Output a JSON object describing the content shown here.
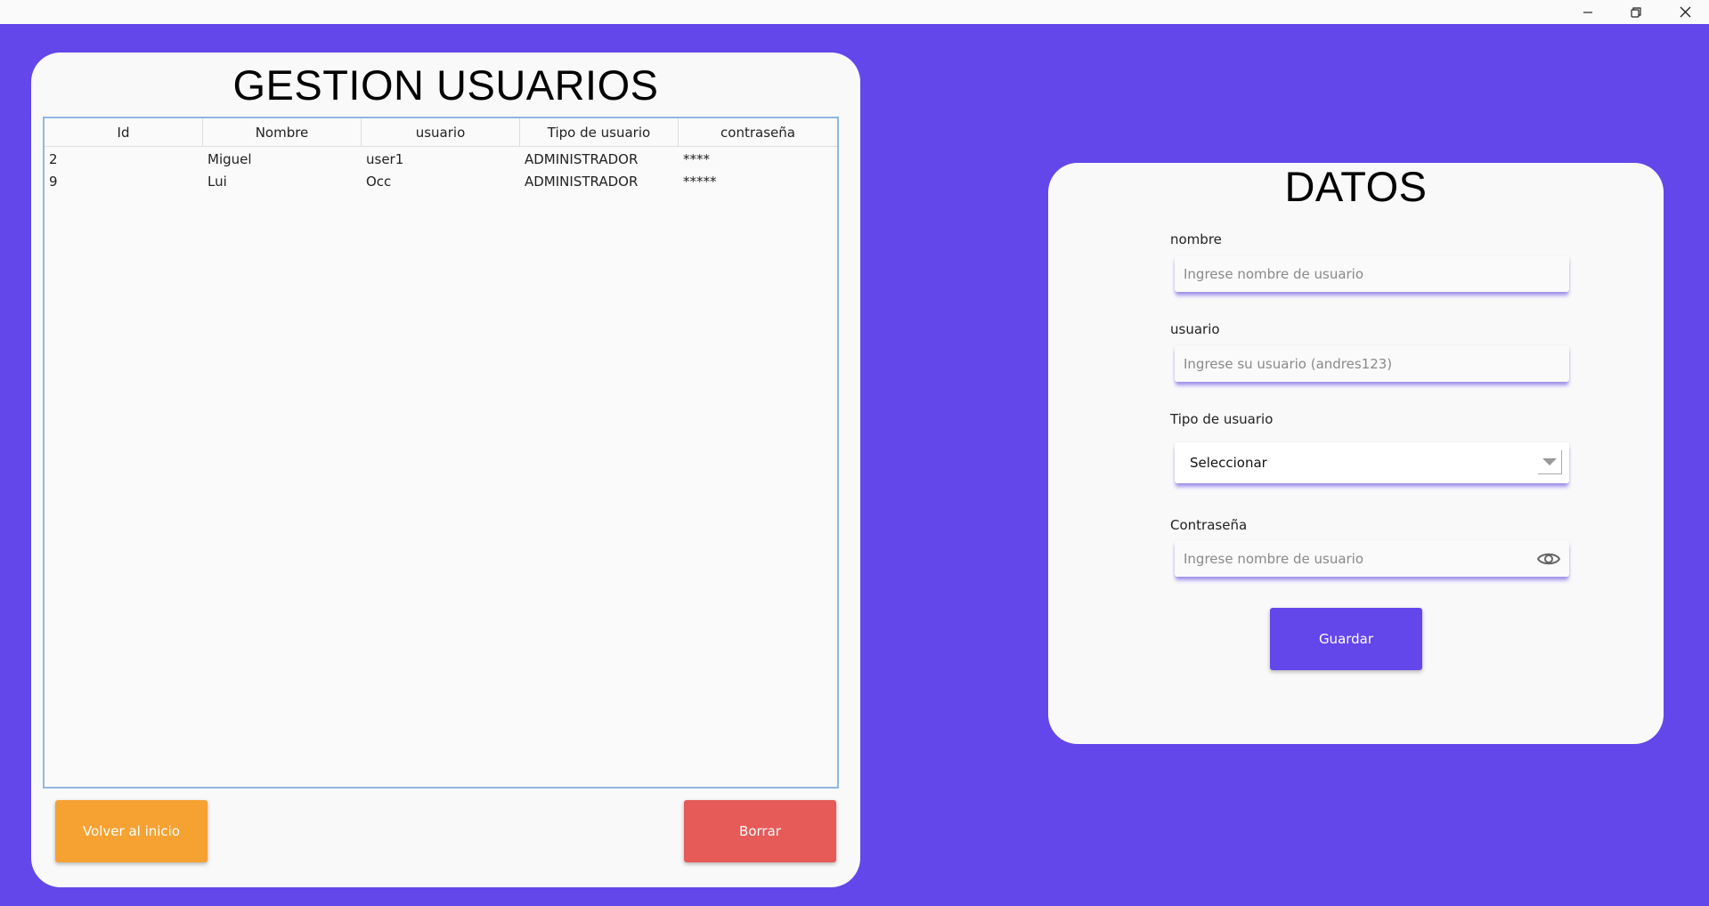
{
  "window": {
    "controls": [
      "minimize-icon",
      "restore-icon",
      "close-icon"
    ]
  },
  "colors": {
    "background": "#6347ea",
    "panel": "#f9f9f9",
    "home_button": "#f6a232",
    "delete_button": "#e65a58",
    "save_button": "#6347ea",
    "table_border": "#8fb8df"
  },
  "users_panel": {
    "title": "GESTION USUARIOS",
    "table": {
      "columns": [
        "Id",
        "Nombre",
        "usuario",
        "Tipo de usuario",
        "contraseña"
      ],
      "rows": [
        [
          "2",
          "Miguel",
          "user1",
          "ADMINISTRADOR",
          "****"
        ],
        [
          "9",
          "Lui",
          "Occ",
          "ADMINISTRADOR",
          "*****"
        ]
      ]
    },
    "home_button": "Volver al inicio",
    "delete_button": "Borrar"
  },
  "data_panel": {
    "title": "DATOS",
    "fields": {
      "nombre": {
        "label": "nombre",
        "placeholder": "Ingrese nombre de usuario",
        "value": ""
      },
      "usuario": {
        "label": "usuario",
        "placeholder": "Ingrese su usuario (andres123)",
        "value": ""
      },
      "tipo": {
        "label": "Tipo de usuario",
        "value": "Seleccionar"
      },
      "password": {
        "label": "Contraseña",
        "placeholder": "Ingrese nombre de usuario",
        "value": "",
        "icon": "eye-icon"
      }
    },
    "save_button": "Guardar"
  }
}
